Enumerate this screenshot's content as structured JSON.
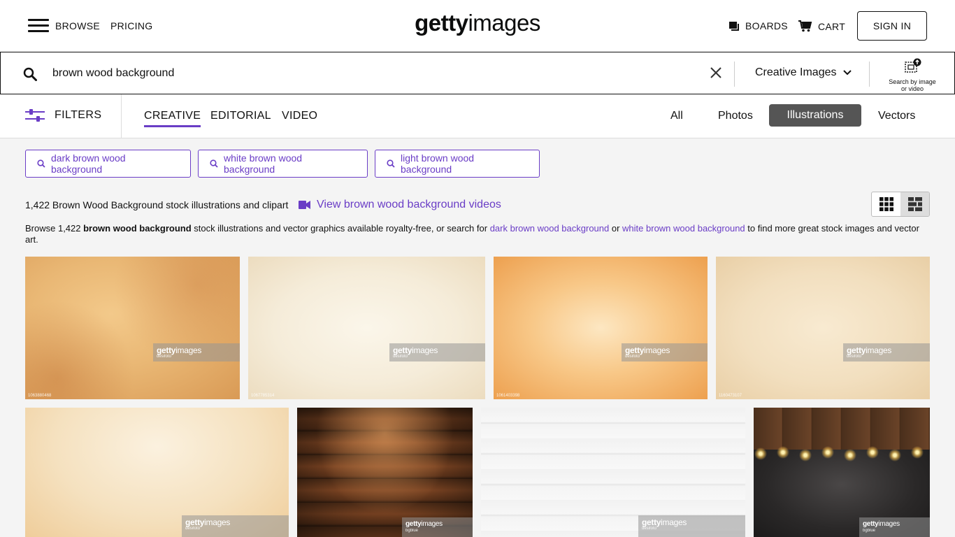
{
  "header": {
    "browse_label": "BROWSE",
    "pricing_label": "PRICING",
    "logo_bold": "getty",
    "logo_regular": "images",
    "boards_label": "BOARDS",
    "cart_label": "CART",
    "signin_label": "SIGN IN"
  },
  "search": {
    "query": "brown wood background",
    "asset_type": "Creative Images",
    "search_by_image_line1": "Search by image",
    "search_by_image_line2": "or video"
  },
  "filters": {
    "filters_label": "FILTERS",
    "tabs": [
      {
        "label": "CREATIVE",
        "active": true
      },
      {
        "label": "EDITORIAL",
        "active": false
      },
      {
        "label": "VIDEO",
        "active": false
      }
    ],
    "media_types": [
      {
        "label": "All",
        "active": false
      },
      {
        "label": "Photos",
        "active": false
      },
      {
        "label": "Illustrations",
        "active": true
      },
      {
        "label": "Vectors",
        "active": false
      }
    ]
  },
  "related_searches": [
    "dark brown wood background",
    "white brown wood background",
    "light brown wood background"
  ],
  "results": {
    "count_text": "1,422 Brown Wood Background stock illustrations and clipart",
    "video_link_text": "View brown wood background videos",
    "desc_prefix": "Browse 1,422 ",
    "desc_bold": "brown wood background",
    "desc_mid1": " stock illustrations and vector graphics available royalty-free, or search for ",
    "desc_link1": "dark brown wood background",
    "desc_mid2": " or ",
    "desc_link2": "white brown wood background",
    "desc_suffix": " to find more great stock images and vector art."
  },
  "images": [
    {
      "watermark_bold": "getty",
      "watermark_regular": "images",
      "credit": "desifoto",
      "id": "1063880468"
    },
    {
      "watermark_bold": "getty",
      "watermark_regular": "images",
      "credit": "desifoto",
      "id": "1067785314"
    },
    {
      "watermark_bold": "getty",
      "watermark_regular": "images",
      "credit": "desifoto",
      "id": "1061403398"
    },
    {
      "watermark_bold": "getty",
      "watermark_regular": "images",
      "credit": "desifoto",
      "id": "1160473107"
    },
    {
      "watermark_bold": "getty",
      "watermark_regular": "images",
      "credit": "desifoto",
      "id": ""
    },
    {
      "watermark_bold": "getty",
      "watermark_regular": "images",
      "credit": "bgblue",
      "id": ""
    },
    {
      "watermark_bold": "getty",
      "watermark_regular": "images",
      "credit": "desifoto",
      "id": ""
    },
    {
      "watermark_bold": "getty",
      "watermark_regular": "images",
      "credit": "bgblue",
      "id": ""
    }
  ],
  "colors": {
    "accent": "#6a3dc6",
    "active_media_tab": "#555555",
    "background": "#f4f4f4"
  }
}
